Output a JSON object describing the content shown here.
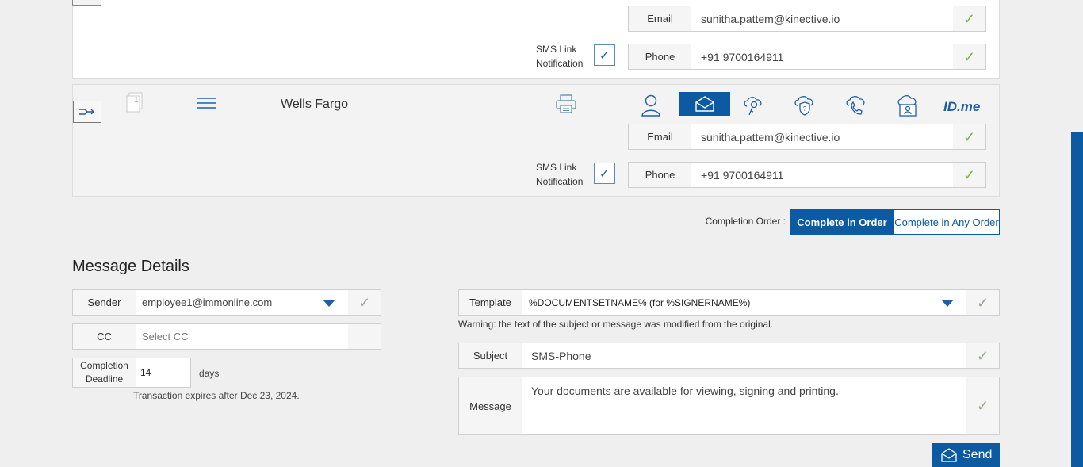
{
  "signer1": {
    "email_label": "Email",
    "email_value": "sunitha.pattem@kinective.io",
    "sms_label_line1": "SMS Link",
    "sms_label_line2": "Notification",
    "phone_label": "Phone",
    "phone_value": "+91 9700164911"
  },
  "signer2": {
    "name": "Wells Fargo",
    "doc_count": "1",
    "auth_logo_text": "ID.me",
    "email_label": "Email",
    "email_value": "sunitha.pattem@kinective.io",
    "sms_label_line1": "SMS Link",
    "sms_label_line2": "Notification",
    "phone_label": "Phone",
    "phone_value": "+91 9700164911"
  },
  "completion_order": {
    "label": "Completion Order :",
    "option_in_order": "Complete in Order",
    "option_any_order": "Complete in Any Order",
    "selected": "Complete in Order"
  },
  "message_details": {
    "title": "Message Details",
    "sender_label": "Sender",
    "sender_value": "employee1@immonline.com",
    "cc_label": "CC",
    "cc_placeholder": "Select CC",
    "deadline_label_line1": "Completion",
    "deadline_label_line2": "Deadline",
    "deadline_value": "14",
    "deadline_unit": "days",
    "expires_text": "Transaction expires after Dec 23, 2024.",
    "template_label": "Template",
    "template_value": "%DOCUMENTSETNAME% (for %SIGNERNAME%)",
    "warning_text": "Warning: the text of the subject or message was modified from the original.",
    "subject_label": "Subject",
    "subject_value": "SMS-Phone",
    "message_label": "Message",
    "message_value": "Your documents are available for viewing, signing and printing.",
    "send_label": "Send"
  },
  "colors": {
    "accent": "#0b5aa2",
    "check": "#7cb342",
    "background": "#efefef"
  },
  "icons": {
    "auth_methods": [
      "person-icon",
      "envelope-icon",
      "key-cloud-icon",
      "shield-question-icon",
      "phone-call-icon",
      "id-card-icon",
      "idme-logo"
    ]
  }
}
